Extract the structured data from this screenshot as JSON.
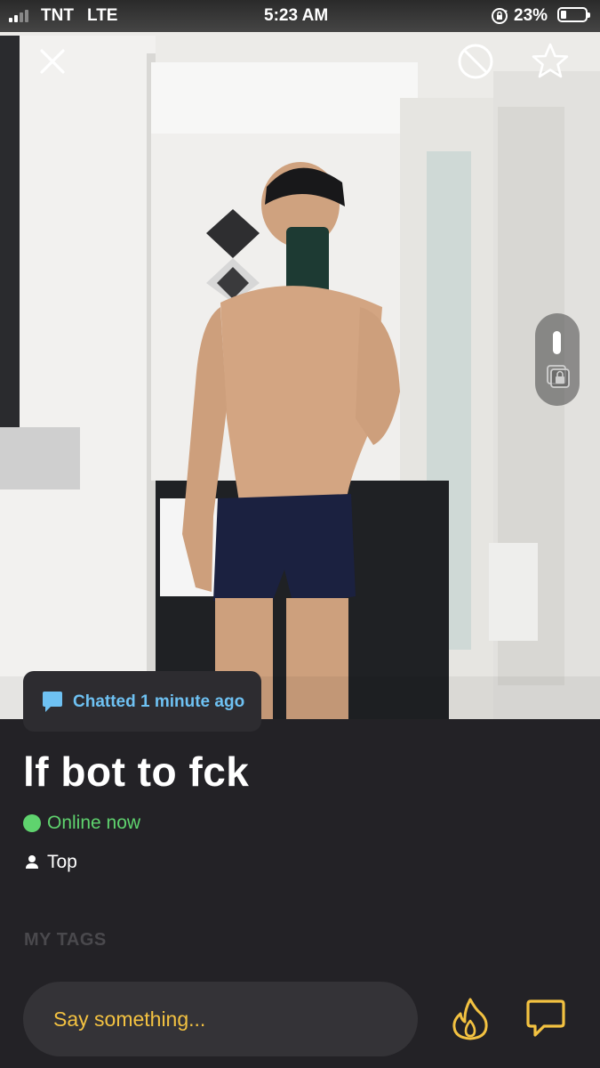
{
  "status_bar": {
    "carrier": "TNT",
    "network": "LTE",
    "time": "5:23 AM",
    "battery_percent": "23%",
    "battery_level": 0.23,
    "signal_bars": 2
  },
  "photo": {
    "controls": {
      "close_icon": "close-icon",
      "block_icon": "block-icon",
      "favorite_icon": "star-icon"
    },
    "pager": {
      "lock_icon": "private-album-lock-icon"
    }
  },
  "chat_status": {
    "icon": "chat-bubble-icon",
    "text": "Chatted 1 minute ago",
    "color": "#6ec1f2"
  },
  "profile": {
    "display_name": "lf bot to fck",
    "online_status": "Online now",
    "online_color": "#5fd36e",
    "role": "Top",
    "tags_heading": "MY TAGS"
  },
  "composer": {
    "placeholder": "Say something...",
    "accent_color": "#f3c241",
    "tap_icon": "flame-icon",
    "chat_icon": "chat-icon"
  }
}
